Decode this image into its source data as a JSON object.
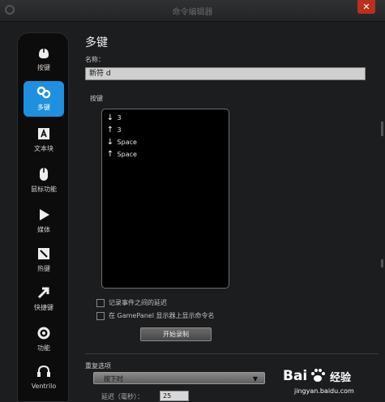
{
  "window": {
    "title": "命令编辑器",
    "close_glyph": "✕"
  },
  "sidebar": {
    "items": [
      {
        "label": "按键",
        "icon": "mouse-icon"
      },
      {
        "label": "多键",
        "icon": "multikey-icon",
        "active": true
      },
      {
        "label": "文本块",
        "icon": "text-block-icon"
      },
      {
        "label": "鼠标功能",
        "icon": "mouse-function-icon"
      },
      {
        "label": "媒体",
        "icon": "play-icon"
      },
      {
        "label": "热键",
        "icon": "hotkey-icon"
      },
      {
        "label": "快捷键",
        "icon": "shortcut-arrow-icon"
      },
      {
        "label": "功能",
        "icon": "gear-icon"
      },
      {
        "label": "Ventrilo",
        "icon": "headset-icon"
      }
    ]
  },
  "main": {
    "title": "多键",
    "name_label": "名称：",
    "name_value": "新符 d",
    "keys_label": "按键",
    "keys": [
      {
        "arrow": "↓",
        "key": "3"
      },
      {
        "arrow": "↑",
        "key": "3"
      },
      {
        "arrow": "↓",
        "key": "Space"
      },
      {
        "arrow": "↑",
        "key": "Space"
      }
    ],
    "options": [
      {
        "label": "记录事件之间的延迟"
      },
      {
        "label": "在 GamePanel 显示器上显示命令名"
      }
    ],
    "record_button": "开始录制",
    "repeat_label": "重复选项",
    "repeat_select": "按下时",
    "delay_label": "延迟（毫秒）：",
    "delay_value": "25"
  },
  "watermark": {
    "logo": "Bai",
    "brand": "经验",
    "url": "jingyan.baidu.com"
  },
  "colors": {
    "accent": "#1f8fe0",
    "close": "#b8301f",
    "background": "#1c1d1f"
  }
}
